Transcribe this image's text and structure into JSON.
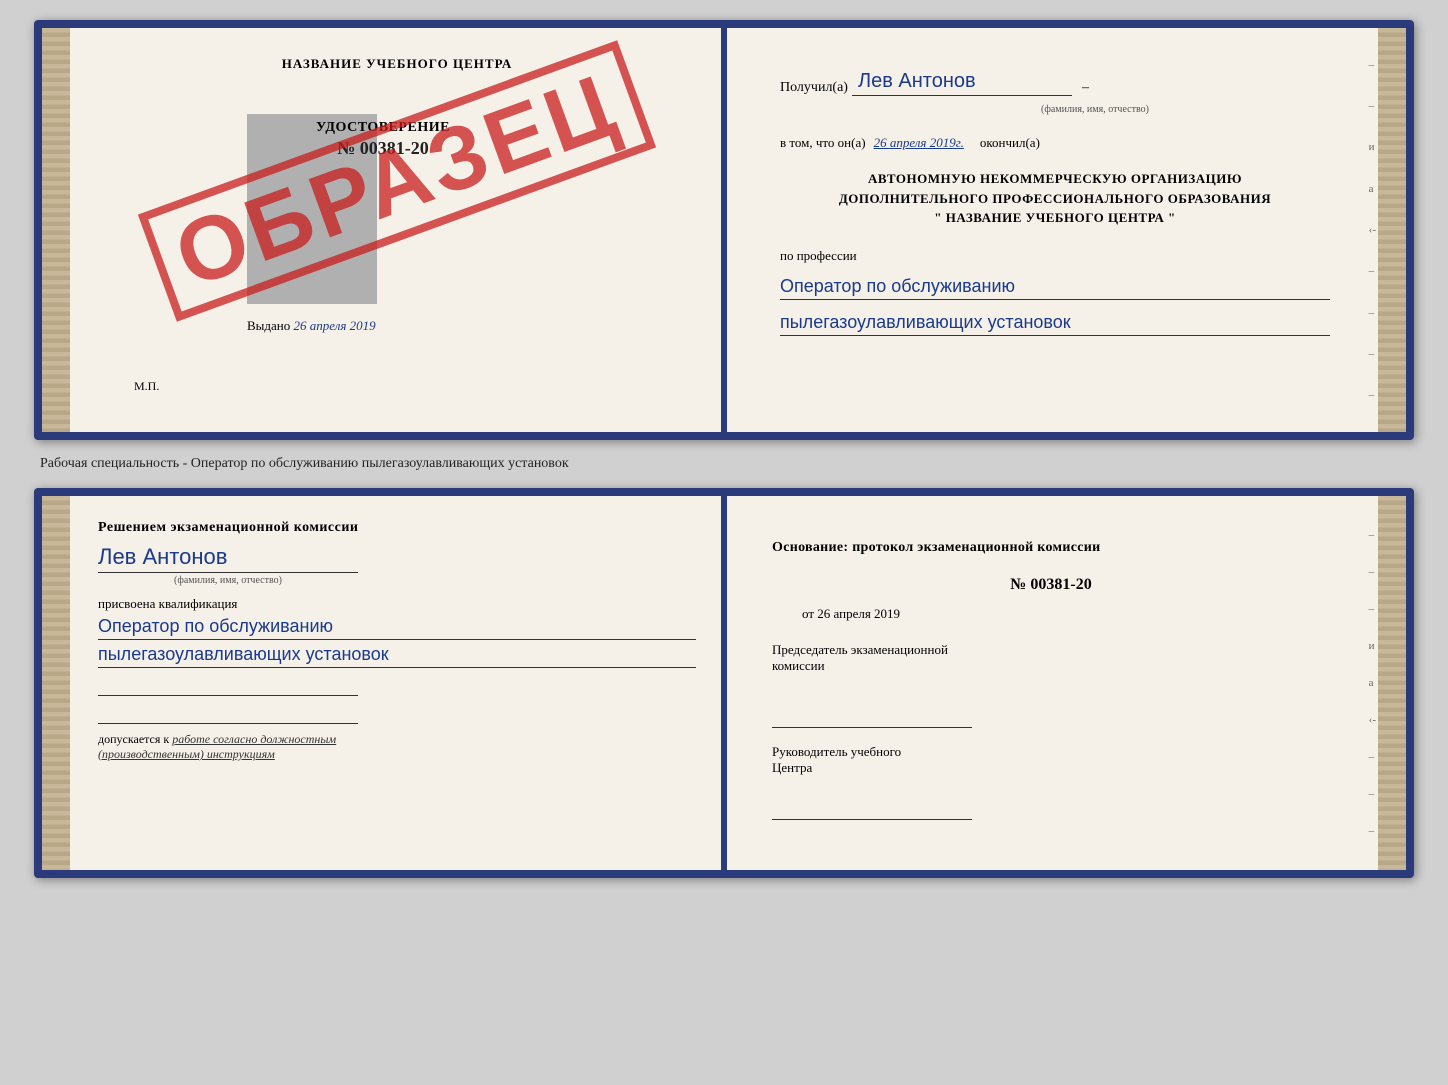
{
  "top_booklet": {
    "left_page": {
      "school_name": "НАЗВАНИЕ УЧЕБНОГО ЦЕНТРА",
      "cert_title": "УДОСТОВЕРЕНИЕ",
      "cert_number": "№ 00381-20",
      "issued_label": "Выдано",
      "issued_date": "26 апреля 2019",
      "mp_label": "М.П.",
      "stamp_text": "ОБРАЗЕЦ"
    },
    "right_page": {
      "recipient_label": "Получил(а)",
      "recipient_name": "Лев Антонов",
      "fio_hint": "(фамилия, имя, отчество)",
      "date_prefix": "в том, что он(а)",
      "date_value": "26 апреля 2019г.",
      "date_suffix": "окончил(а)",
      "org_line1": "АВТОНОМНУЮ НЕКОММЕРЧЕСКУЮ ОРГАНИЗАЦИЮ",
      "org_line2": "ДОПОЛНИТЕЛЬНОГО ПРОФЕССИОНАЛЬНОГО ОБРАЗОВАНИЯ",
      "org_line3": "\"  НАЗВАНИЕ УЧЕБНОГО ЦЕНТРА  \"",
      "profession_label": "по профессии",
      "profession_line1": "Оператор по обслуживанию",
      "profession_line2": "пылегазоулавливающих установок"
    }
  },
  "middle_label": "Рабочая специальность - Оператор по обслуживанию пылегазоулавливающих установок",
  "bottom_booklet": {
    "left_page": {
      "decision_text": "Решением экзаменационной комиссии",
      "person_name": "Лев Антонов",
      "fio_hint": "(фамилия, имя, отчество)",
      "qualification_label": "присвоена квалификация",
      "qualification_line1": "Оператор по обслуживанию",
      "qualification_line2": "пылегазоулавливающих установок",
      "admission_prefix": "допускается к",
      "admission_italic": "работе согласно должностным",
      "admission_italic2": "(производственным) инструкциям"
    },
    "right_page": {
      "basis_text": "Основание: протокол экзаменационной комиссии",
      "protocol_number": "№ 00381-20",
      "protocol_date_prefix": "от",
      "protocol_date": "26 апреля 2019",
      "chairman_label": "Председатель экзаменационной",
      "chairman_label2": "комиссии",
      "director_label": "Руководитель учебного",
      "director_label2": "Центра"
    }
  }
}
